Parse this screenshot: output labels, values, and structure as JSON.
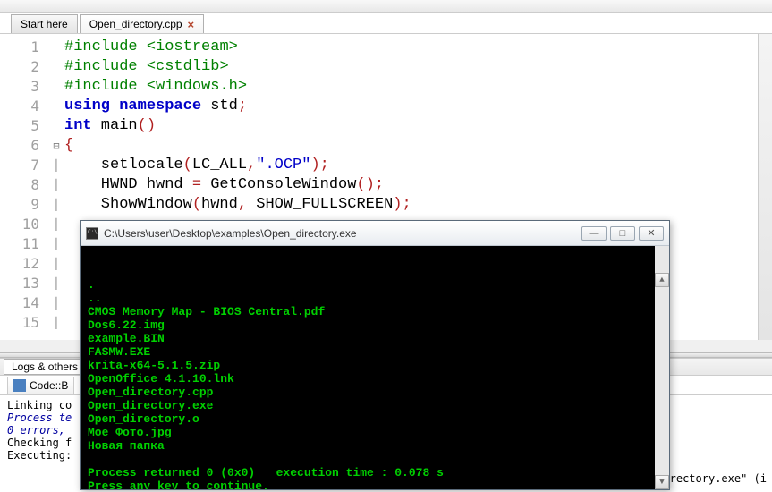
{
  "tabs": {
    "start": "Start here",
    "file": "Open_directory.cpp"
  },
  "code_lines": [
    {
      "n": 1,
      "tokens": [
        [
          "pp",
          "#include "
        ],
        [
          "inc",
          "<iostream>"
        ]
      ],
      "fold": ""
    },
    {
      "n": 2,
      "tokens": [
        [
          "pp",
          "#include "
        ],
        [
          "inc",
          "<cstdlib>"
        ]
      ],
      "fold": ""
    },
    {
      "n": 3,
      "tokens": [
        [
          "pp",
          "#include "
        ],
        [
          "inc",
          "<windows.h>"
        ]
      ],
      "fold": ""
    },
    {
      "n": 4,
      "tokens": [
        [
          "kw",
          "using namespace"
        ],
        [
          "ident",
          " std"
        ],
        [
          "punct",
          ";"
        ]
      ],
      "fold": ""
    },
    {
      "n": 5,
      "tokens": [
        [
          "kw",
          "int"
        ],
        [
          "ident",
          " main"
        ],
        [
          "punct",
          "()"
        ]
      ],
      "fold": ""
    },
    {
      "n": 6,
      "tokens": [
        [
          "punct",
          "{"
        ]
      ],
      "fold": "⊟"
    },
    {
      "n": 7,
      "tokens": [
        [
          "ident",
          "    setlocale"
        ],
        [
          "punct",
          "("
        ],
        [
          "ident",
          "LC_ALL"
        ],
        [
          "punct",
          ","
        ],
        [
          "str",
          "\".OCP\""
        ],
        [
          "punct",
          ");"
        ]
      ],
      "fold": "│"
    },
    {
      "n": 8,
      "tokens": [
        [
          "ident",
          "    HWND hwnd "
        ],
        [
          "punct",
          "="
        ],
        [
          "ident",
          " GetConsoleWindow"
        ],
        [
          "punct",
          "();"
        ]
      ],
      "fold": "│"
    },
    {
      "n": 9,
      "tokens": [
        [
          "ident",
          "    ShowWindow"
        ],
        [
          "punct",
          "("
        ],
        [
          "ident",
          "hwnd"
        ],
        [
          "punct",
          ","
        ],
        [
          "ident",
          " SHOW_FULLSCREEN"
        ],
        [
          "punct",
          ");"
        ]
      ],
      "fold": "│"
    },
    {
      "n": 10,
      "tokens": [
        [
          "ident",
          " "
        ]
      ],
      "fold": "│"
    },
    {
      "n": 11,
      "tokens": [
        [
          "ident",
          " "
        ]
      ],
      "fold": "│"
    },
    {
      "n": 12,
      "tokens": [
        [
          "ident",
          " "
        ]
      ],
      "fold": "│"
    },
    {
      "n": 13,
      "tokens": [
        [
          "ident",
          " "
        ]
      ],
      "fold": "│"
    },
    {
      "n": 14,
      "tokens": [
        [
          "ident",
          " "
        ]
      ],
      "fold": "│"
    },
    {
      "n": 15,
      "tokens": [
        [
          "ident",
          " "
        ]
      ],
      "fold": "│"
    }
  ],
  "bottom": {
    "panel_tab": "Logs & others",
    "sub_tab": "Code::B",
    "log_lines": [
      {
        "cls": "",
        "text": "Linking co"
      },
      {
        "cls": "blue-italic",
        "text": "Process te"
      },
      {
        "cls": "blue-italic",
        "text": "0 errors,"
      },
      {
        "cls": "",
        "text": " "
      },
      {
        "cls": "",
        "text": "Checking f"
      },
      {
        "cls": "",
        "text": "Executing:"
      }
    ],
    "right_fragment": "rectory.exe\" (i"
  },
  "console": {
    "title": "C:\\Users\\user\\Desktop\\examples\\Open_directory.exe",
    "lines": [
      ".",
      "..",
      "CMOS Memory Map - BIOS Central.pdf",
      "Dos6.22.img",
      "example.BIN",
      "FASMW.EXE",
      "krita-x64-5.1.5.zip",
      "OpenOffice 4.1.10.lnk",
      "Open_directory.cpp",
      "Open_directory.exe",
      "Open_directory.o",
      "Moe_Фото.jpg",
      "Новая папка",
      "",
      "Process returned 0 (0x0)   execution time : 0.078 s",
      "Press any key to continue."
    ]
  }
}
